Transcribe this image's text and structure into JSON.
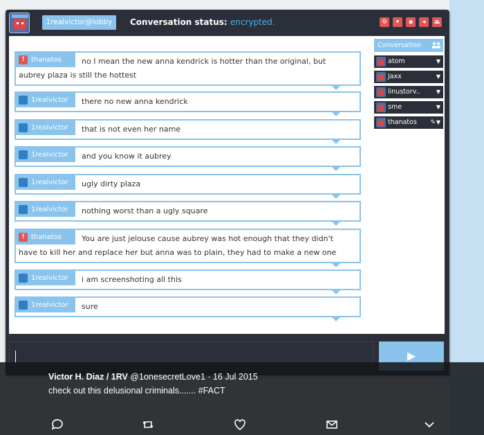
{
  "app": {
    "user": "1realvictor@lobby",
    "status_label": "Conversation status:",
    "status_value": "encrypted.",
    "toolbar_icons": [
      "settings-icon",
      "filter-icon",
      "chat-icon",
      "sound-icon",
      "eject-icon"
    ]
  },
  "messages": [
    {
      "user": "thanatos",
      "flag": "red",
      "text": "no I mean the new anna kendrick is hotter than the original, but aubrey plaza is still the hottest"
    },
    {
      "user": "1realvictor",
      "flag": "blue",
      "text": "there no new anna kendrick"
    },
    {
      "user": "1realvictor",
      "flag": "blue",
      "text": "that is not even her name"
    },
    {
      "user": "1realvictor",
      "flag": "blue",
      "text": "and you know it aubrey"
    },
    {
      "user": "1realvictor",
      "flag": "blue",
      "text": "ugly dirty plaza"
    },
    {
      "user": "1realvictor",
      "flag": "blue",
      "text": "nothing worst than a ugly square"
    },
    {
      "user": "thanatos",
      "flag": "red",
      "text": "You are just jelouse cause aubrey was hot enough that they didn't have to kill her and replace her but anna was to plain, they had to make a new one"
    },
    {
      "user": "1realvictor",
      "flag": "blue",
      "text": "i am screenshoting all this"
    },
    {
      "user": "1realvictor",
      "flag": "blue",
      "text": "sure"
    }
  ],
  "sidebar": {
    "header": "Conversation",
    "users": [
      "atom",
      "Jaxx",
      "linustorv..",
      "sme",
      "thanatos"
    ]
  },
  "input": {
    "placeholder": "",
    "send_label": "▶"
  },
  "tweet": {
    "author": "Victor H. Diaz / 1RV",
    "handle": "@1onesecretLove1",
    "sep": " · ",
    "date": "16 Jul 2015",
    "text": "check out this delusional criminals....... #FACT"
  },
  "colors": {
    "accent": "#8ac3ec",
    "alert": "#e25555",
    "dark": "#2b2f39",
    "status": "#4cb0f2"
  }
}
